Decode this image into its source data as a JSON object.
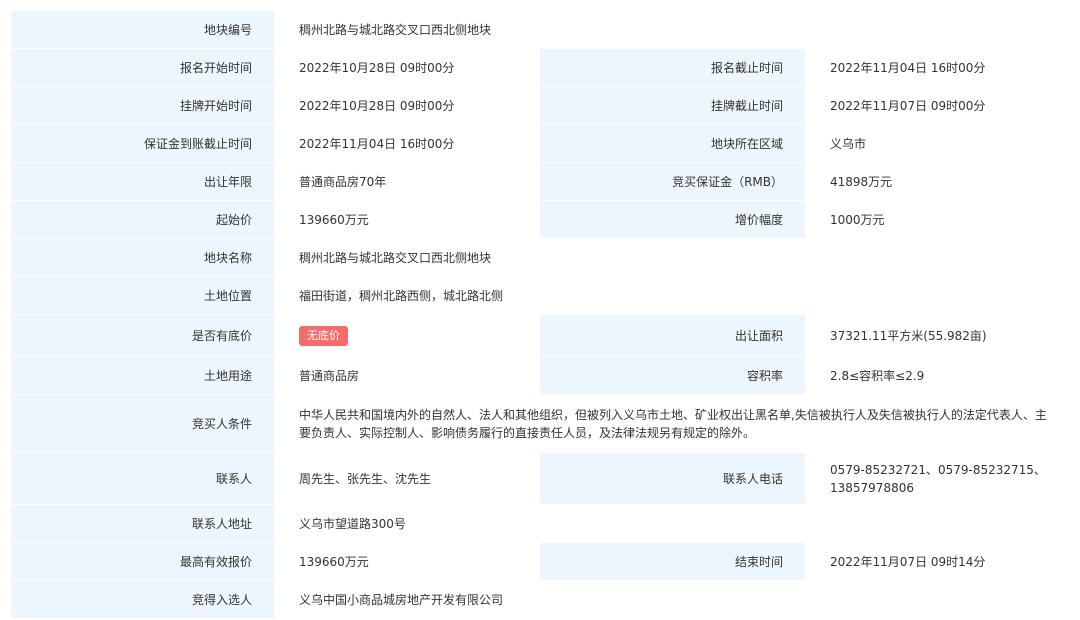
{
  "rows": [
    {
      "l1": "地块编号",
      "v1": "稠州北路与城北路交叉口西北侧地块"
    },
    {
      "l1": "报名开始时间",
      "v1": "2022年10月28日 09时00分",
      "l2": "报名截止时间",
      "v2": "2022年11月04日 16时00分"
    },
    {
      "l1": "挂牌开始时间",
      "v1": "2022年10月28日 09时00分",
      "l2": "挂牌截止时间",
      "v2": "2022年11月07日 09时00分"
    },
    {
      "l1": "保证金到账截止时间",
      "v1": "2022年11月04日 16时00分",
      "l2": "地块所在区域",
      "v2": "义乌市"
    },
    {
      "l1": "出让年限",
      "v1": "普通商品房70年",
      "l2": "竞买保证金（RMB）",
      "v2": "41898万元"
    },
    {
      "l1": "起始价",
      "v1": "139660万元",
      "l2": "增价幅度",
      "v2": "1000万元"
    },
    {
      "l1": "地块名称",
      "v1": "稠州北路与城北路交叉口西北侧地块"
    },
    {
      "l1": "土地位置",
      "v1": "福田街道，稠州北路西侧，城北路北侧"
    },
    {
      "l1": "是否有底价",
      "v1": "无底价",
      "l2": "出让面积",
      "v2": "37321.11平方米(55.982亩)"
    },
    {
      "l1": "土地用途",
      "v1": "普通商品房",
      "l2": "容积率",
      "v2": "2.8≤容积率≤2.9"
    },
    {
      "l1": "竞买人条件",
      "v1": "中华人民共和国境内外的自然人、法人和其他组织，但被列入义乌市土地、矿业权出让黑名单,失信被执行人及失信被执行人的法定代表人、主要负责人、实际控制人、影响债务履行的直接责任人员，及法律法规另有规定的除外。"
    },
    {
      "l1": "联系人",
      "v1": "周先生、张先生、沈先生",
      "l2": "联系人电话",
      "v2": "0579-85232721、0579-85232715、13857978806"
    },
    {
      "l1": "联系人地址",
      "v1": "义乌市望道路300号"
    },
    {
      "l1": "最高有效报价",
      "v1": "139660万元",
      "l2": "结束时间",
      "v2": "2022年11月07日 09时14分"
    },
    {
      "l1": "竞得入选人",
      "v1": "义乌中国小商品城房地产开发有限公司"
    }
  ]
}
